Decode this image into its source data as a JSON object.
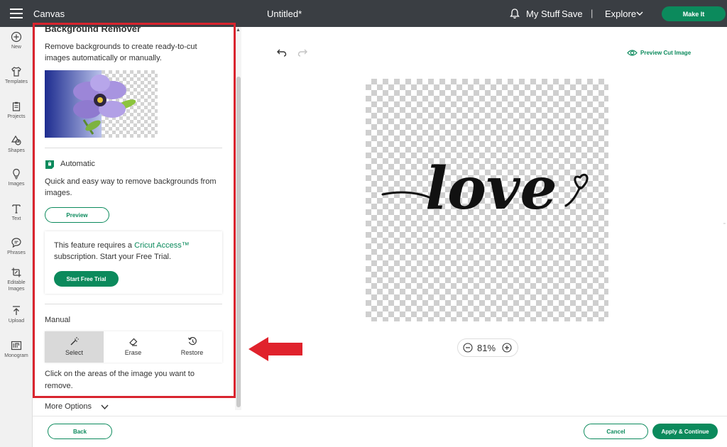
{
  "topbar": {
    "app_title": "Canvas",
    "doc_title": "Untitled*",
    "my_stuff": "My Stuff",
    "save": "Save",
    "divider": "|",
    "explore": "Explore",
    "make_it": "Make It"
  },
  "sidebar": {
    "items": [
      {
        "label": "New",
        "icon": "plus-circle-icon"
      },
      {
        "label": "Templates",
        "icon": "shirt-icon"
      },
      {
        "label": "Projects",
        "icon": "clipboard-icon"
      },
      {
        "label": "Shapes",
        "icon": "shapes-icon"
      },
      {
        "label": "Images",
        "icon": "lightbulb-icon"
      },
      {
        "label": "Text",
        "icon": "text-icon"
      },
      {
        "label": "Phrases",
        "icon": "speech-bubble-icon"
      },
      {
        "label": "Editable Images",
        "icon": "editable-image-icon"
      },
      {
        "label": "Upload",
        "icon": "upload-icon"
      },
      {
        "label": "Monogram",
        "icon": "monogram-icon"
      }
    ]
  },
  "panel": {
    "title": "Background Remover",
    "description": "Remove backgrounds to create ready-to-cut images automatically or manually.",
    "automatic": {
      "label": "Automatic",
      "description": "Quick and easy way to remove backgrounds from images.",
      "preview_button": "Preview"
    },
    "access": {
      "text_before": "This feature requires a ",
      "link": "Cricut Access™",
      "text_after": " subscription. Start your Free Trial.",
      "trial_button": "Start Free Trial"
    },
    "manual": {
      "label": "Manual",
      "tools": [
        {
          "label": "Select",
          "icon": "magic-wand-icon",
          "active": true
        },
        {
          "label": "Erase",
          "icon": "eraser-icon",
          "active": false
        },
        {
          "label": "Restore",
          "icon": "restore-history-icon",
          "active": false
        }
      ],
      "description": "Click on the areas of the image you want to remove."
    },
    "more_options": "More Options"
  },
  "canvas": {
    "preview_cut_image": "Preview Cut Image",
    "zoom": "81%",
    "artwork_text": "love"
  },
  "footer": {
    "back": "Back",
    "cancel": "Cancel",
    "apply": "Apply & Continue"
  },
  "colors": {
    "topbar": "#3a3e43",
    "accent": "#0b8a5c",
    "highlight": "#d9242e"
  }
}
